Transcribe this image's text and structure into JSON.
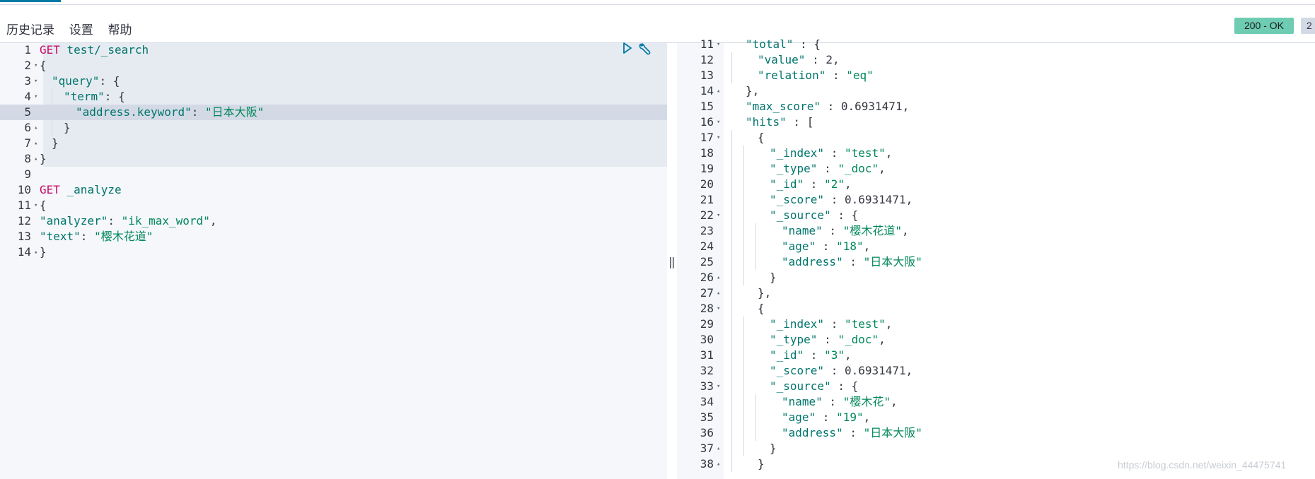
{
  "menu": [
    "历史记录",
    "设置",
    "帮助"
  ],
  "status": {
    "ok": "200 - OK",
    "time": "2"
  },
  "request_lines": [
    {
      "n": "1",
      "fold": "",
      "ind": 0,
      "tokens": [
        [
          "method",
          "GET"
        ],
        [
          "url",
          " test/_search"
        ]
      ]
    },
    {
      "n": "2",
      "fold": "▾",
      "ind": 0,
      "tokens": [
        [
          "pun",
          "{"
        ]
      ]
    },
    {
      "n": "3",
      "fold": "▾",
      "ind": 1,
      "tokens": [
        [
          "key",
          "\"query\""
        ],
        [
          "pun",
          ": {"
        ]
      ]
    },
    {
      "n": "4",
      "fold": "▾",
      "ind": 2,
      "tokens": [
        [
          "key",
          "\"term\""
        ],
        [
          "pun",
          ": {"
        ]
      ]
    },
    {
      "n": "5",
      "fold": "",
      "ind": 3,
      "tokens": [
        [
          "key",
          "\"address.keyword\""
        ],
        [
          "pun",
          ": "
        ],
        [
          "str",
          "\"日本大阪\""
        ]
      ]
    },
    {
      "n": "6",
      "fold": "▴",
      "ind": 2,
      "tokens": [
        [
          "pun",
          "}"
        ]
      ]
    },
    {
      "n": "7",
      "fold": "▴",
      "ind": 1,
      "tokens": [
        [
          "pun",
          "}"
        ]
      ]
    },
    {
      "n": "8",
      "fold": "▴",
      "ind": 0,
      "tokens": [
        [
          "pun",
          "}"
        ]
      ]
    },
    {
      "n": "9",
      "fold": "",
      "ind": 0,
      "tokens": []
    },
    {
      "n": "10",
      "fold": "",
      "ind": 0,
      "tokens": [
        [
          "method",
          "GET"
        ],
        [
          "url",
          " _analyze"
        ]
      ]
    },
    {
      "n": "11",
      "fold": "▾",
      "ind": 0,
      "tokens": [
        [
          "pun",
          "{"
        ]
      ]
    },
    {
      "n": "12",
      "fold": "",
      "ind": 0,
      "tokens": [
        [
          "key",
          "\"analyzer\""
        ],
        [
          "pun",
          ": "
        ],
        [
          "str",
          "\"ik_max_word\""
        ],
        [
          "pun",
          ","
        ]
      ]
    },
    {
      "n": "13",
      "fold": "",
      "ind": 0,
      "tokens": [
        [
          "key",
          "\"text\""
        ],
        [
          "pun",
          ": "
        ],
        [
          "str",
          "\"樱木花道\""
        ]
      ]
    },
    {
      "n": "14",
      "fold": "▴",
      "ind": 0,
      "tokens": [
        [
          "pun",
          "}"
        ]
      ]
    }
  ],
  "response_lines": [
    {
      "n": "11",
      "fold": "▾",
      "ind": 1,
      "tokens": [
        [
          "key",
          "\"total\""
        ],
        [
          "pun",
          " : {"
        ]
      ]
    },
    {
      "n": "12",
      "fold": "",
      "ind": 2,
      "tokens": [
        [
          "key",
          "\"value\""
        ],
        [
          "pun",
          " : "
        ],
        [
          "num",
          "2"
        ],
        [
          "pun",
          ","
        ]
      ]
    },
    {
      "n": "13",
      "fold": "",
      "ind": 2,
      "tokens": [
        [
          "key",
          "\"relation\""
        ],
        [
          "pun",
          " : "
        ],
        [
          "str",
          "\"eq\""
        ]
      ]
    },
    {
      "n": "14",
      "fold": "▴",
      "ind": 1,
      "tokens": [
        [
          "pun",
          "},"
        ]
      ]
    },
    {
      "n": "15",
      "fold": "",
      "ind": 1,
      "tokens": [
        [
          "key",
          "\"max_score\""
        ],
        [
          "pun",
          " : "
        ],
        [
          "num",
          "0.6931471"
        ],
        [
          "pun",
          ","
        ]
      ]
    },
    {
      "n": "16",
      "fold": "▾",
      "ind": 1,
      "tokens": [
        [
          "key",
          "\"hits\""
        ],
        [
          "pun",
          " : ["
        ]
      ]
    },
    {
      "n": "17",
      "fold": "▾",
      "ind": 2,
      "tokens": [
        [
          "pun",
          "{"
        ]
      ]
    },
    {
      "n": "18",
      "fold": "",
      "ind": 3,
      "tokens": [
        [
          "key",
          "\"_index\""
        ],
        [
          "pun",
          " : "
        ],
        [
          "str",
          "\"test\""
        ],
        [
          "pun",
          ","
        ]
      ]
    },
    {
      "n": "19",
      "fold": "",
      "ind": 3,
      "tokens": [
        [
          "key",
          "\"_type\""
        ],
        [
          "pun",
          " : "
        ],
        [
          "str",
          "\"_doc\""
        ],
        [
          "pun",
          ","
        ]
      ]
    },
    {
      "n": "20",
      "fold": "",
      "ind": 3,
      "tokens": [
        [
          "key",
          "\"_id\""
        ],
        [
          "pun",
          " : "
        ],
        [
          "str",
          "\"2\""
        ],
        [
          "pun",
          ","
        ]
      ]
    },
    {
      "n": "21",
      "fold": "",
      "ind": 3,
      "tokens": [
        [
          "key",
          "\"_score\""
        ],
        [
          "pun",
          " : "
        ],
        [
          "num",
          "0.6931471"
        ],
        [
          "pun",
          ","
        ]
      ]
    },
    {
      "n": "22",
      "fold": "▾",
      "ind": 3,
      "tokens": [
        [
          "key",
          "\"_source\""
        ],
        [
          "pun",
          " : {"
        ]
      ]
    },
    {
      "n": "23",
      "fold": "",
      "ind": 4,
      "tokens": [
        [
          "key",
          "\"name\""
        ],
        [
          "pun",
          " : "
        ],
        [
          "str",
          "\"樱木花道\""
        ],
        [
          "pun",
          ","
        ]
      ]
    },
    {
      "n": "24",
      "fold": "",
      "ind": 4,
      "tokens": [
        [
          "key",
          "\"age\""
        ],
        [
          "pun",
          " : "
        ],
        [
          "str",
          "\"18\""
        ],
        [
          "pun",
          ","
        ]
      ]
    },
    {
      "n": "25",
      "fold": "",
      "ind": 4,
      "tokens": [
        [
          "key",
          "\"address\""
        ],
        [
          "pun",
          " : "
        ],
        [
          "str",
          "\"日本大阪\""
        ]
      ]
    },
    {
      "n": "26",
      "fold": "▴",
      "ind": 3,
      "tokens": [
        [
          "pun",
          "}"
        ]
      ]
    },
    {
      "n": "27",
      "fold": "▴",
      "ind": 2,
      "tokens": [
        [
          "pun",
          "},"
        ]
      ]
    },
    {
      "n": "28",
      "fold": "▾",
      "ind": 2,
      "tokens": [
        [
          "pun",
          "{"
        ]
      ]
    },
    {
      "n": "29",
      "fold": "",
      "ind": 3,
      "tokens": [
        [
          "key",
          "\"_index\""
        ],
        [
          "pun",
          " : "
        ],
        [
          "str",
          "\"test\""
        ],
        [
          "pun",
          ","
        ]
      ]
    },
    {
      "n": "30",
      "fold": "",
      "ind": 3,
      "tokens": [
        [
          "key",
          "\"_type\""
        ],
        [
          "pun",
          " : "
        ],
        [
          "str",
          "\"_doc\""
        ],
        [
          "pun",
          ","
        ]
      ]
    },
    {
      "n": "31",
      "fold": "",
      "ind": 3,
      "tokens": [
        [
          "key",
          "\"_id\""
        ],
        [
          "pun",
          " : "
        ],
        [
          "str",
          "\"3\""
        ],
        [
          "pun",
          ","
        ]
      ]
    },
    {
      "n": "32",
      "fold": "",
      "ind": 3,
      "tokens": [
        [
          "key",
          "\"_score\""
        ],
        [
          "pun",
          " : "
        ],
        [
          "num",
          "0.6931471"
        ],
        [
          "pun",
          ","
        ]
      ]
    },
    {
      "n": "33",
      "fold": "▾",
      "ind": 3,
      "tokens": [
        [
          "key",
          "\"_source\""
        ],
        [
          "pun",
          " : {"
        ]
      ]
    },
    {
      "n": "34",
      "fold": "",
      "ind": 4,
      "tokens": [
        [
          "key",
          "\"name\""
        ],
        [
          "pun",
          " : "
        ],
        [
          "str",
          "\"樱木花\""
        ],
        [
          "pun",
          ","
        ]
      ]
    },
    {
      "n": "35",
      "fold": "",
      "ind": 4,
      "tokens": [
        [
          "key",
          "\"age\""
        ],
        [
          "pun",
          " : "
        ],
        [
          "str",
          "\"19\""
        ],
        [
          "pun",
          ","
        ]
      ]
    },
    {
      "n": "36",
      "fold": "",
      "ind": 4,
      "tokens": [
        [
          "key",
          "\"address\""
        ],
        [
          "pun",
          " : "
        ],
        [
          "str",
          "\"日本大阪\""
        ]
      ]
    },
    {
      "n": "37",
      "fold": "▴",
      "ind": 3,
      "tokens": [
        [
          "pun",
          "}"
        ]
      ]
    },
    {
      "n": "38",
      "fold": "▴",
      "ind": 2,
      "tokens": [
        [
          "pun",
          "}"
        ]
      ]
    }
  ],
  "resizer_glyph": "‖",
  "watermark": "https://blog.csdn.net/weixin_44475741",
  "colors": {
    "accent": "#0079a5",
    "ok_badge": "#6dccb1",
    "method": "#c80a68",
    "key": "#00756c",
    "string": "#00875a"
  }
}
